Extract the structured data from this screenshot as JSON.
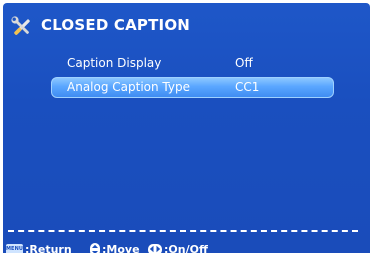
{
  "header": {
    "title": "CLOSED CAPTION",
    "icon": "tools-icon"
  },
  "menu": {
    "items": [
      {
        "label": "Caption Display",
        "value": "Off",
        "selected": false
      },
      {
        "label": "Analog Caption Type",
        "value": "CC1",
        "selected": true
      }
    ]
  },
  "footer": {
    "return_key": "MENU",
    "return_label": ":Return",
    "move_label": ":Move",
    "onoff_label": ":On/Off"
  },
  "colors": {
    "background": "#1a4fbf",
    "highlight": "#5aa6ff",
    "text": "#ffffff"
  }
}
